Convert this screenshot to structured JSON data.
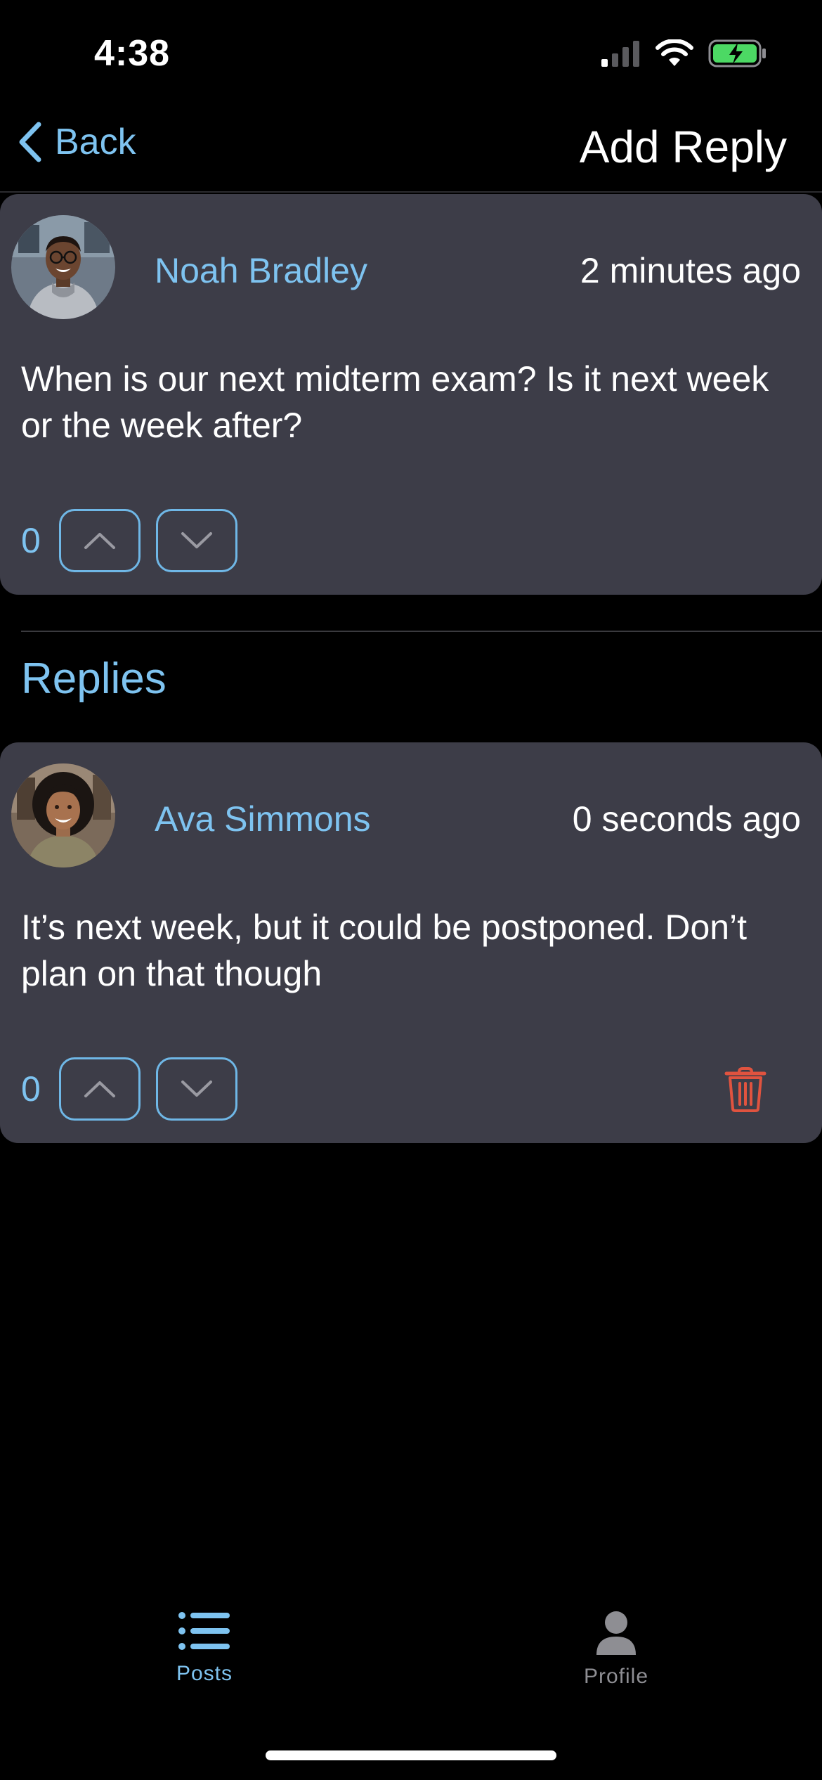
{
  "status_bar": {
    "time": "4:38"
  },
  "nav": {
    "back_label": "Back",
    "title": "Add Reply"
  },
  "post": {
    "author": "Noah Bradley",
    "timestamp": "2 minutes ago",
    "body": "When is our next midterm exam? Is it next week or the week after?",
    "votes": "0"
  },
  "replies_section": {
    "title": "Replies",
    "items": [
      {
        "author": "Ava Simmons",
        "timestamp": "0 seconds ago",
        "body": "It’s next week, but it could be postponed. Don’t plan on that though",
        "votes": "0"
      }
    ]
  },
  "tab_bar": {
    "tabs": [
      {
        "label": "Posts",
        "icon": "list-icon",
        "active": true
      },
      {
        "label": "Profile",
        "icon": "person-icon",
        "active": false
      }
    ]
  },
  "colors": {
    "accent": "#7ec3f0",
    "card_bg": "#3d3d48",
    "delete": "#e0533f",
    "inactive_tab": "#8e8e93"
  }
}
